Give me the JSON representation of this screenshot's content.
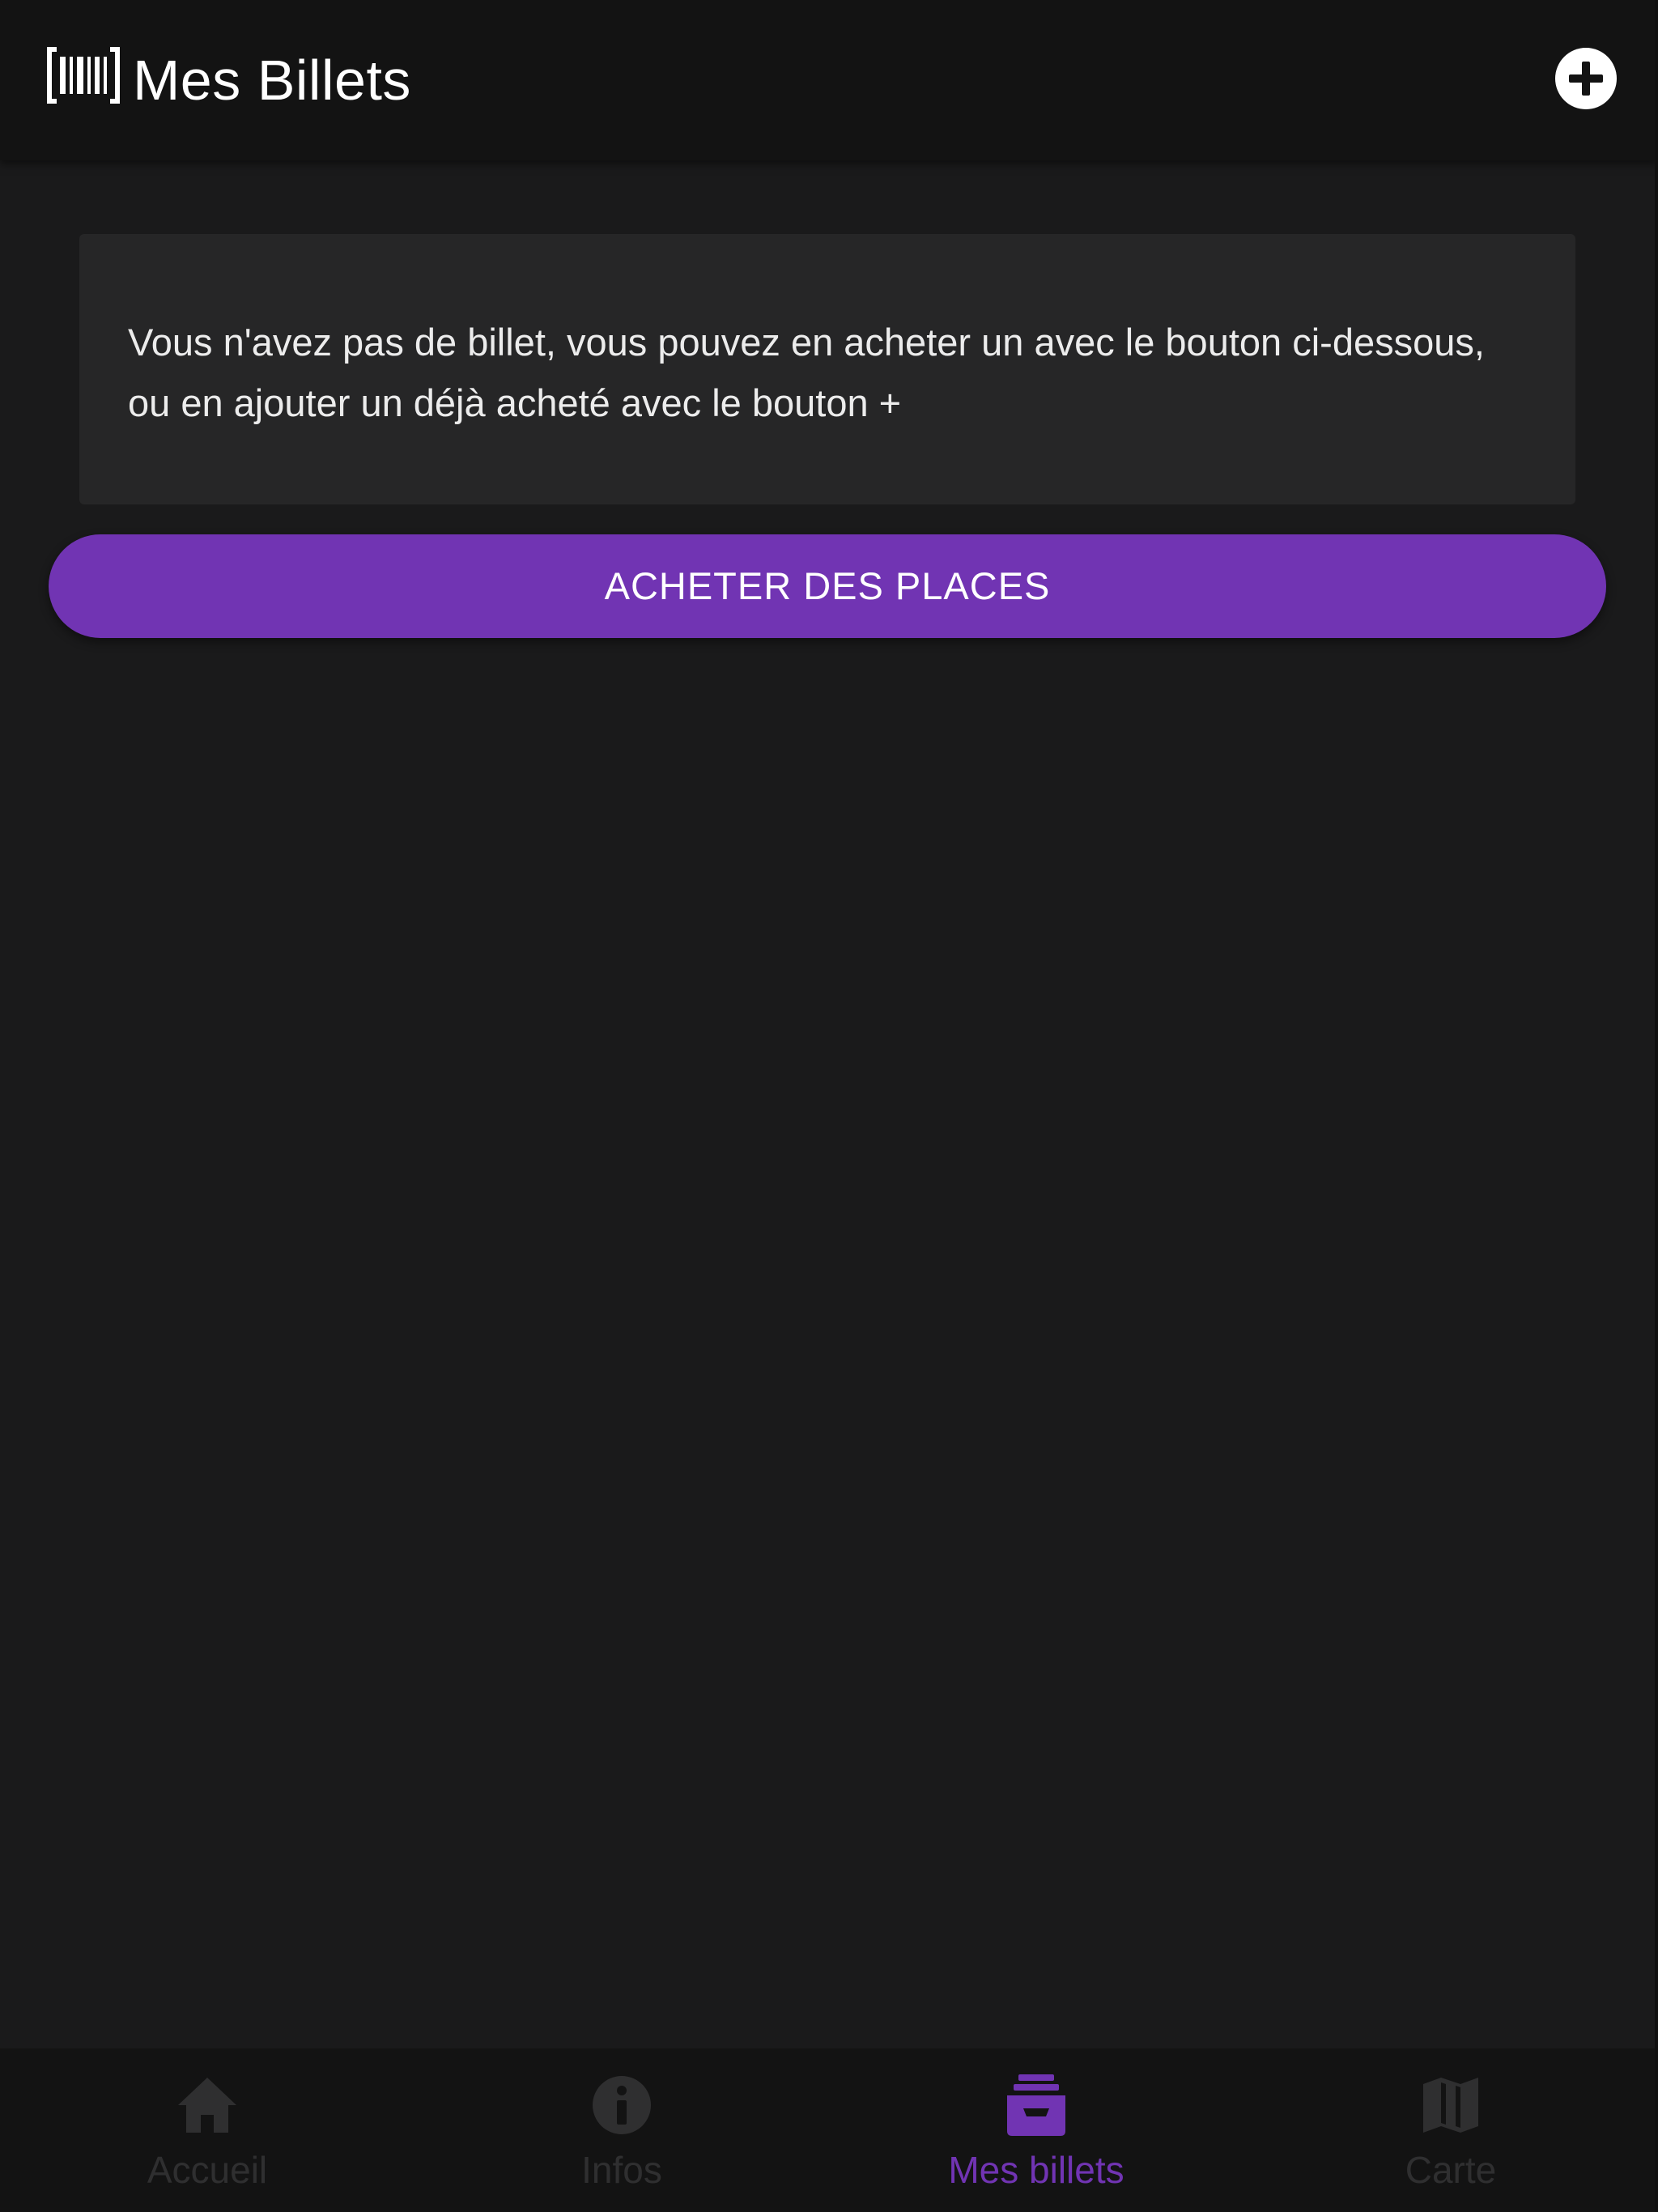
{
  "header": {
    "title": "Mes Billets",
    "logo_icon": "barcode-icon",
    "add_icon": "plus-circle-icon"
  },
  "main": {
    "empty_message": "Vous n'avez pas de billet, vous pouvez en acheter un avec le bouton ci-dessous, ou en ajouter un déjà acheté avec le bouton +",
    "buy_button_label": "ACHETER DES PLACES"
  },
  "bottom_nav": {
    "items": [
      {
        "label": "Accueil",
        "icon": "home-icon",
        "active": false
      },
      {
        "label": "Infos",
        "icon": "info-icon",
        "active": false
      },
      {
        "label": "Mes billets",
        "icon": "ticket-tray-icon",
        "active": true
      },
      {
        "label": "Carte",
        "icon": "map-icon",
        "active": false
      }
    ]
  },
  "colors": {
    "background": "#1a1a1b",
    "header_background": "#131313",
    "card_background": "#262627",
    "accent": "#7134b3",
    "inactive_nav": "#2f2f30",
    "text": "#ececec"
  }
}
